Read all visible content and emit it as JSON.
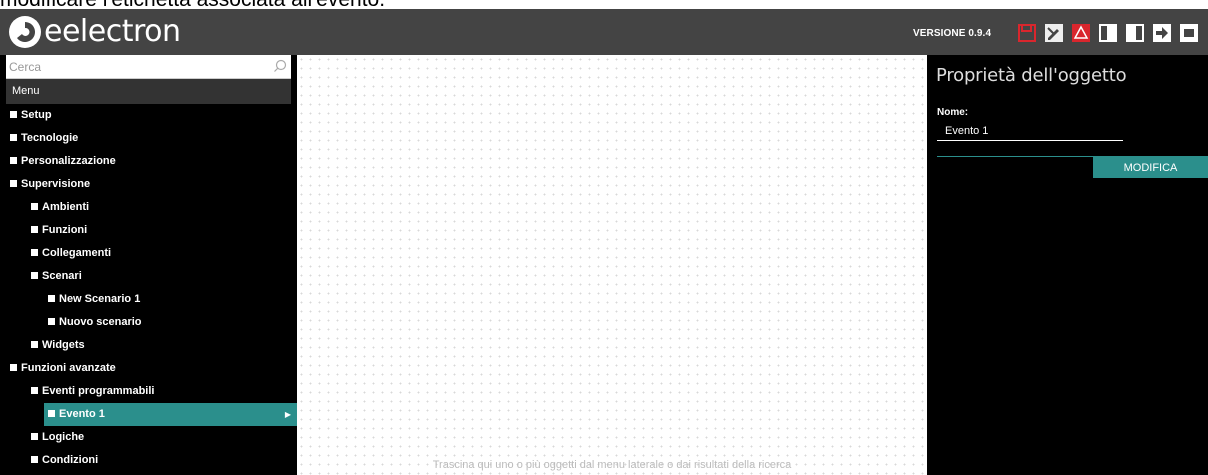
{
  "caption": "modificare l'etichetta associata all'evento.",
  "header": {
    "logo_text": "eelectron",
    "version": "VERSIONE 0.9.4",
    "toolbar_icons": [
      "save-icon",
      "edit-icon",
      "warning-icon",
      "left-panel-icon",
      "right-panel-icon",
      "export-icon",
      "more-icon"
    ],
    "accent_red": "#d9262d"
  },
  "sidebar": {
    "search_placeholder": "Cerca",
    "menu_label": "Menu",
    "items": [
      {
        "label": "Setup",
        "level": 0
      },
      {
        "label": "Tecnologie",
        "level": 0
      },
      {
        "label": "Personalizzazione",
        "level": 0
      },
      {
        "label": "Supervisione",
        "level": 0
      },
      {
        "label": "Ambienti",
        "level": 1
      },
      {
        "label": "Funzioni",
        "level": 1
      },
      {
        "label": "Collegamenti",
        "level": 1
      },
      {
        "label": "Scenari",
        "level": 1
      },
      {
        "label": "New Scenario 1",
        "level": 2
      },
      {
        "label": "Nuovo scenario",
        "level": 2
      },
      {
        "label": "Widgets",
        "level": 1
      },
      {
        "label": "Funzioni avanzate",
        "level": 0
      },
      {
        "label": "Eventi programmabili",
        "level": 1
      },
      {
        "label": "Evento 1",
        "level": 2,
        "selected": true
      },
      {
        "label": "Logiche",
        "level": 1
      },
      {
        "label": "Condizioni",
        "level": 1
      }
    ]
  },
  "canvas": {
    "hint": "Trascina qui uno o più oggetti dal menu laterale o dai risultati della ricerca"
  },
  "properties": {
    "title": "Proprietà dell'oggetto",
    "name_label": "Nome:",
    "name_value": "Evento 1",
    "modify_button": "MODIFICA"
  },
  "colors": {
    "accent": "#2b8f8c",
    "topbar": "#444444",
    "panel": "#000000"
  }
}
